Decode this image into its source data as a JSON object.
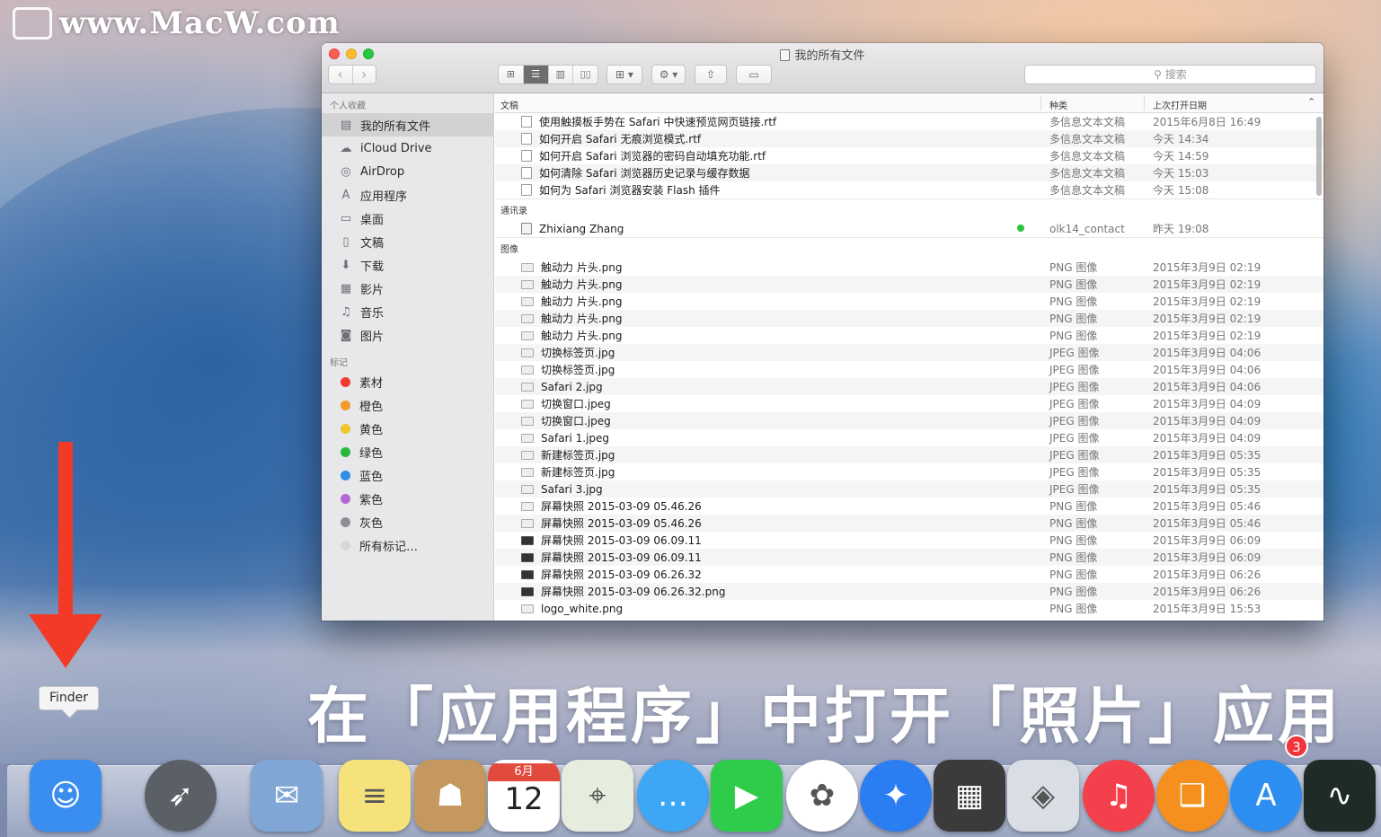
{
  "watermark": {
    "text": "www.MacW.com"
  },
  "window": {
    "title": "我的所有文件",
    "search_placeholder": "搜索",
    "sidebar": {
      "favorites_heading": "个人收藏",
      "favorites": [
        {
          "label": "我的所有文件",
          "icon": "all-files-icon",
          "selected": true
        },
        {
          "label": "iCloud Drive",
          "icon": "cloud-icon"
        },
        {
          "label": "AirDrop",
          "icon": "airdrop-icon"
        },
        {
          "label": "应用程序",
          "icon": "applications-icon"
        },
        {
          "label": "桌面",
          "icon": "desktop-icon"
        },
        {
          "label": "文稿",
          "icon": "documents-icon"
        },
        {
          "label": "下载",
          "icon": "download-icon"
        },
        {
          "label": "影片",
          "icon": "movies-icon"
        },
        {
          "label": "音乐",
          "icon": "music-icon"
        },
        {
          "label": "图片",
          "icon": "camera-icon"
        }
      ],
      "tags_heading": "标记",
      "tags": [
        {
          "label": "素材",
          "color": "#f23a30"
        },
        {
          "label": "橙色",
          "color": "#f39a2a"
        },
        {
          "label": "黄色",
          "color": "#efc62b"
        },
        {
          "label": "绿色",
          "color": "#27b93c"
        },
        {
          "label": "蓝色",
          "color": "#2f8ee8"
        },
        {
          "label": "紫色",
          "color": "#b566d6"
        },
        {
          "label": "灰色",
          "color": "#8e8e93"
        },
        {
          "label": "所有标记…",
          "color": "#d8d8da"
        }
      ]
    },
    "columns": {
      "name": "文稿",
      "kind": "种类",
      "date": "上次打开日期"
    },
    "groups": [
      {
        "heading": "",
        "rows": [
          {
            "name": "使用触摸板手势在 Safari 中快速预览网页链接.rtf",
            "kind": "多信息文本文稿",
            "date": "2015年6月8日 16:49",
            "icon": "doc"
          },
          {
            "name": "如何开启 Safari 无痕浏览模式.rtf",
            "kind": "多信息文本文稿",
            "date": "今天 14:34",
            "icon": "doc"
          },
          {
            "name": "如何开启 Safari 浏览器的密码自动填充功能.rtf",
            "kind": "多信息文本文稿",
            "date": "今天 14:59",
            "icon": "doc"
          },
          {
            "name": "如何清除 Safari 浏览器历史记录与缓存数据",
            "kind": "多信息文本文稿",
            "date": "今天 15:03",
            "icon": "doc"
          },
          {
            "name": "如何为 Safari 浏览器安装 Flash 插件",
            "kind": "多信息文本文稿",
            "date": "今天 15:08",
            "icon": "doc"
          }
        ]
      },
      {
        "heading": "通讯录",
        "rows": [
          {
            "name": "Zhixiang Zhang",
            "kind": "olk14_contact",
            "date": "昨天 19:08",
            "icon": "card",
            "status": true
          }
        ]
      },
      {
        "heading": "图像",
        "rows": [
          {
            "name": "触动力 片头.png",
            "kind": "PNG 图像",
            "date": "2015年3月9日 02:19",
            "icon": "img"
          },
          {
            "name": "触动力 片头.png",
            "kind": "PNG 图像",
            "date": "2015年3月9日 02:19",
            "icon": "img"
          },
          {
            "name": "触动力 片头.png",
            "kind": "PNG 图像",
            "date": "2015年3月9日 02:19",
            "icon": "img"
          },
          {
            "name": "触动力 片头.png",
            "kind": "PNG 图像",
            "date": "2015年3月9日 02:19",
            "icon": "img"
          },
          {
            "name": "触动力 片头.png",
            "kind": "PNG 图像",
            "date": "2015年3月9日 02:19",
            "icon": "img"
          },
          {
            "name": "切换标签页.jpg",
            "kind": "JPEG 图像",
            "date": "2015年3月9日 04:06",
            "icon": "img"
          },
          {
            "name": "切换标签页.jpg",
            "kind": "JPEG 图像",
            "date": "2015年3月9日 04:06",
            "icon": "img"
          },
          {
            "name": "Safari 2.jpg",
            "kind": "JPEG 图像",
            "date": "2015年3月9日 04:06",
            "icon": "img"
          },
          {
            "name": "切换窗口.jpeg",
            "kind": "JPEG 图像",
            "date": "2015年3月9日 04:09",
            "icon": "img"
          },
          {
            "name": "切换窗口.jpeg",
            "kind": "JPEG 图像",
            "date": "2015年3月9日 04:09",
            "icon": "img"
          },
          {
            "name": "Safari 1.jpeg",
            "kind": "JPEG 图像",
            "date": "2015年3月9日 04:09",
            "icon": "img"
          },
          {
            "name": "新建标签页.jpg",
            "kind": "JPEG 图像",
            "date": "2015年3月9日 05:35",
            "icon": "img"
          },
          {
            "name": "新建标签页.jpg",
            "kind": "JPEG 图像",
            "date": "2015年3月9日 05:35",
            "icon": "img"
          },
          {
            "name": "Safari 3.jpg",
            "kind": "JPEG 图像",
            "date": "2015年3月9日 05:35",
            "icon": "img"
          },
          {
            "name": "屏幕快照 2015-03-09 05.46.26",
            "kind": "PNG 图像",
            "date": "2015年3月9日 05:46",
            "icon": "img"
          },
          {
            "name": "屏幕快照 2015-03-09 05.46.26",
            "kind": "PNG 图像",
            "date": "2015年3月9日 05:46",
            "icon": "img"
          },
          {
            "name": "屏幕快照 2015-03-09 06.09.11",
            "kind": "PNG 图像",
            "date": "2015年3月9日 06:09",
            "icon": "shot"
          },
          {
            "name": "屏幕快照 2015-03-09 06.09.11",
            "kind": "PNG 图像",
            "date": "2015年3月9日 06:09",
            "icon": "shot"
          },
          {
            "name": "屏幕快照 2015-03-09 06.26.32",
            "kind": "PNG 图像",
            "date": "2015年3月9日 06:26",
            "icon": "shot"
          },
          {
            "name": "屏幕快照 2015-03-09 06.26.32.png",
            "kind": "PNG 图像",
            "date": "2015年3月9日 06:26",
            "icon": "shot"
          },
          {
            "name": "logo_white.png",
            "kind": "PNG 图像",
            "date": "2015年3月9日 15:53",
            "icon": "img"
          }
        ]
      }
    ]
  },
  "caption": "在「应用程序」中打开「照片」应用",
  "tooltip": "Finder",
  "dock": [
    {
      "name": "finder",
      "icon": "finder-icon",
      "bg": "#3a8ef0"
    },
    {
      "name": "launchpad",
      "icon": "rocket-icon",
      "bg": "#5b5f66",
      "round": true
    },
    {
      "name": "mail-stamp",
      "icon": "eagle-stamp-icon",
      "bg": "#7fa6d4"
    },
    {
      "name": "notes",
      "icon": "notepad-icon",
      "bg": "#f6e27a"
    },
    {
      "name": "contacts",
      "icon": "contacts-book-icon",
      "bg": "#c4985f"
    },
    {
      "name": "calendar",
      "icon": "calendar-icon",
      "bg": "#ffffff",
      "month": "6月",
      "day": "12"
    },
    {
      "name": "maps",
      "icon": "maps-icon",
      "bg": "#e6eddf"
    },
    {
      "name": "messages",
      "icon": "messages-icon",
      "bg": "#3da6f5",
      "round": true
    },
    {
      "name": "facetime",
      "icon": "facetime-icon",
      "bg": "#2fcc4b"
    },
    {
      "name": "photos",
      "icon": "photos-icon",
      "bg": "#ffffff",
      "round": true
    },
    {
      "name": "safari",
      "icon": "safari-compass-icon",
      "bg": "#2b7ef2",
      "round": true
    },
    {
      "name": "final-cut",
      "icon": "clapperboard-icon",
      "bg": "#3b3b3b"
    },
    {
      "name": "preview",
      "icon": "preview-icon",
      "bg": "#d9dde4"
    },
    {
      "name": "itunes",
      "icon": "music-note-icon",
      "bg": "#f3404c",
      "round": true
    },
    {
      "name": "ibooks",
      "icon": "book-icon",
      "bg": "#f5901e",
      "round": true
    },
    {
      "name": "app-store",
      "icon": "app-store-icon",
      "bg": "#2d8ef1",
      "round": true,
      "badge": "3"
    },
    {
      "name": "activity-monitor",
      "icon": "activity-graph-icon",
      "bg": "#1f2b27"
    }
  ]
}
